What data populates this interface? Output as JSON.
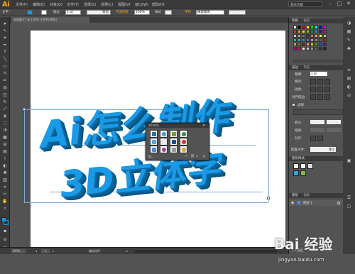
{
  "menubar": {
    "logo": "Ai",
    "items": [
      "文件(F)",
      "编辑(E)",
      "对象(O)",
      "文字(T)",
      "选择(S)",
      "效果(C)",
      "视图(V)",
      "窗口(W)",
      "帮助(H)"
    ],
    "preset": "基本功能",
    "window_buttons": [
      "–",
      "□",
      "✕"
    ]
  },
  "controlbar": {
    "tool_label": "文字",
    "stroke_label": "描边",
    "stroke_value": "1 pt",
    "stroke_style": "等比",
    "opacity_label": "不透明度",
    "opacity_value": "100%",
    "style_label": "样式",
    "char_label": "字符",
    "font_value": "微软雅黑"
  },
  "document": {
    "tab_title": "未标题-1* @ 100% (CMYK/预览)"
  },
  "artwork": {
    "line1": "Ai怎么制作",
    "line2": "3D立体字",
    "color": "#1a9ae6"
  },
  "symbols_panel": {
    "title": "3D 符号",
    "swatch_colors": [
      "#2a6fb0",
      "#3aa0d8",
      "#7a9a3a",
      "#2d8a4e",
      "#5aa0e0",
      "#e8e8e8",
      "#1a4f9a",
      "#cc3333",
      "#4a8ad0",
      "#b03a9a",
      "#9a9a9a",
      "#e0a030"
    ],
    "footer": "描..."
  },
  "statusbar": {
    "zoom": "100%",
    "page": "1",
    "mode": "编组选择"
  },
  "right_panel": {
    "swatches_tab": "色板",
    "swatches_tab2": "画笔",
    "stroke_tab": "描边",
    "stroke_tab2": "渐变",
    "weight_label": "粗细:",
    "weight_value": "1 pt",
    "cap_label": "端点:",
    "corner_label": "边角:",
    "align_label": "对齐描边:",
    "dashed_label": "虚线",
    "arrow_label": "箭头:",
    "scale_label": "缩放:",
    "align_label2": "对齐:",
    "profile_label": "配置文件:",
    "profile_value": "等比",
    "graphic_styles_tab": "图形样式",
    "layers_tab": "图层",
    "layers_tab2": "画板",
    "layer_name": "图层 1",
    "layer_count": "1 个图层"
  },
  "watermark": {
    "brand": "Bai 经验",
    "url": "jingyan.baidu.com"
  },
  "swatch_palette": [
    "#ffffff",
    "#000000",
    "#ff0000",
    "#ffff00",
    "#00ff00",
    "#00ffff",
    "#0000ff",
    "#ff00ff",
    "#e6332a",
    "#f39800",
    "#fff100",
    "#8fc31f",
    "#009944",
    "#00a0e9",
    "#1d2088",
    "#e4007f",
    "#c9caca",
    "#9fa0a0",
    "#727171",
    "#3e3a39",
    "#eb6877",
    "#f6ad3c",
    "#fff45c",
    "#b3d465",
    "#32b16c",
    "#13b5b1",
    "#448aca",
    "#556fb5",
    "#a3a3a3",
    "#888888",
    "#5f5f5f",
    "#c30d23",
    "#d9a35e",
    "#996c33",
    "#6a3906",
    "#f29b76",
    "#fcc800",
    "#22ac38",
    "#0068b7",
    "#601986",
    "#920783",
    "#e5004f",
    "#ffffff",
    "#cccccc",
    "#999999",
    "#666666",
    "#333333",
    "#1a1a1a"
  ]
}
